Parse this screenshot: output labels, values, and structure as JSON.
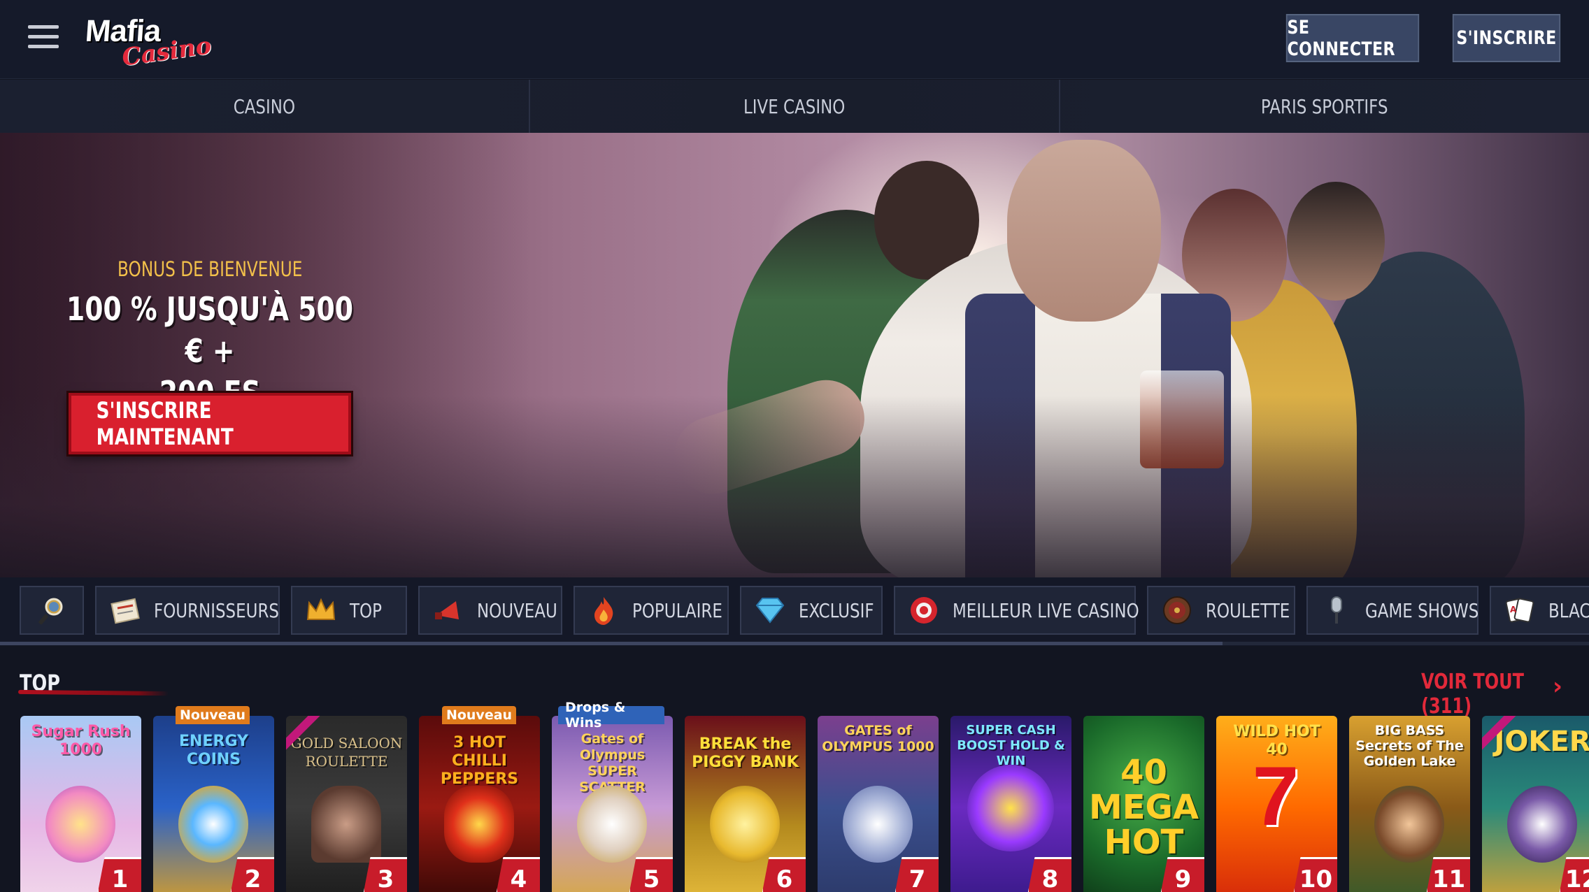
{
  "header": {
    "logo_primary": "Mafia",
    "logo_secondary": "Casino",
    "login_label": "SE CONNECTER",
    "register_label": "S'INSCRIRE"
  },
  "category_tabs": [
    {
      "label": "CASINO"
    },
    {
      "label": "LIVE CASINO"
    },
    {
      "label": "PARIS SPORTIFS"
    }
  ],
  "hero": {
    "subtitle": "BONUS DE BIENVENUE",
    "title_line1": "100 % JUSQU'À 500 € +",
    "title_line2": "200 FS",
    "cta_label": "S'INSCRIRE MAINTENANT"
  },
  "filters": [
    {
      "label": "",
      "icon": "search-icon"
    },
    {
      "label": "FOURNISSEURS",
      "icon": "providers-icon"
    },
    {
      "label": "TOP",
      "icon": "crown-icon"
    },
    {
      "label": "NOUVEAU",
      "icon": "megaphone-icon"
    },
    {
      "label": "POPULAIRE",
      "icon": "fire-icon"
    },
    {
      "label": "EXCLUSIF",
      "icon": "diamond-icon"
    },
    {
      "label": "MEILLEUR LIVE CASINO",
      "icon": "chips-icon"
    },
    {
      "label": "ROULETTE",
      "icon": "roulette-icon"
    },
    {
      "label": "GAME SHOWS",
      "icon": "microphone-icon"
    },
    {
      "label": "BLAC",
      "icon": "cards-icon"
    }
  ],
  "section": {
    "title": "TOP",
    "see_all": "VOIR TOUT (311)"
  },
  "badges": {
    "new": "Nouveau",
    "drops": "Drops & Wins"
  },
  "games": [
    {
      "title": "Sugar Rush 1000",
      "rank": "1"
    },
    {
      "title": "ENERGY COINS",
      "rank": "2"
    },
    {
      "title": "GOLD SALOON ROULETTE",
      "rank": "3"
    },
    {
      "title": "3 HOT CHILLI PEPPERS",
      "rank": "4"
    },
    {
      "title": "Gates of Olympus SUPER SCATTER",
      "rank": "5"
    },
    {
      "title": "BREAK the PIGGY BANK",
      "rank": "6"
    },
    {
      "title": "GATES of OLYMPUS 1000",
      "rank": "7"
    },
    {
      "title": "SUPER CASH BOOST HOLD & WIN",
      "rank": "8"
    },
    {
      "title": "40 MEGA HOT",
      "rank": "9"
    },
    {
      "title": "WILD HOT 40",
      "rank": "10"
    },
    {
      "title": "BIG BASS Secrets of The Golden Lake",
      "rank": "11"
    },
    {
      "title": "JOKER",
      "rank": "12"
    }
  ]
}
